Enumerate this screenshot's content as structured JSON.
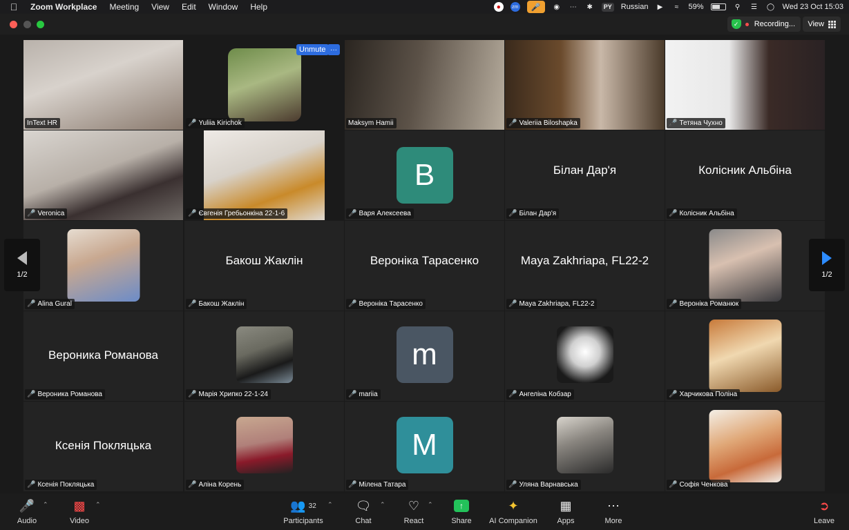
{
  "menubar": {
    "app_name": "Zoom Workplace",
    "items": [
      "Meeting",
      "View",
      "Edit",
      "Window",
      "Help"
    ],
    "keyboard_code": "PY",
    "keyboard_label": "Russian",
    "battery": "59%",
    "datetime": "Wed 23 Oct  15:03",
    "zm_badge": "zm"
  },
  "titlebar": {
    "recording_label": "Recording...",
    "view_label": "View"
  },
  "pager": {
    "left_label": "1/2",
    "right_label": "1/2"
  },
  "self_tile": {
    "unmute_label": "Unmute",
    "more_label": "···"
  },
  "participants": [
    {
      "name": "InText HR",
      "type": "video",
      "active": true
    },
    {
      "name": "Yuliia Kirichok",
      "type": "video"
    },
    {
      "name": "Maksym Hamii",
      "type": "video"
    },
    {
      "name": "Valeriia Biloshapka",
      "type": "video"
    },
    {
      "name": "Тетяна Чухно",
      "type": "video"
    },
    {
      "name": "Veronica",
      "type": "video"
    },
    {
      "name": "Євгенія Гребьонкіна 22-1-6",
      "type": "video"
    },
    {
      "name": "Варя Алексеева",
      "type": "avatar",
      "initial": "B",
      "color": "#2e8b7a"
    },
    {
      "name": "Білан Дар'я",
      "type": "name"
    },
    {
      "name": "Колісник Альбіна",
      "type": "name"
    },
    {
      "name": "Alina Gural",
      "type": "photo"
    },
    {
      "name": "Бакош Жаклін",
      "type": "name"
    },
    {
      "name": "Вероніка Тарасенко",
      "type": "name"
    },
    {
      "name": "Maya Zakhriapa, FL22-2",
      "type": "name"
    },
    {
      "name": "Вероніка Романюк",
      "type": "photo"
    },
    {
      "name": "Вероника Романова",
      "type": "name"
    },
    {
      "name": "Марія Хрипко 22-1-24",
      "type": "photo"
    },
    {
      "name": "mariia",
      "type": "avatar",
      "initial": "m",
      "color": "#4a5663"
    },
    {
      "name": "Ангеліна Кобзар",
      "type": "photo"
    },
    {
      "name": "Харчикова Поліна",
      "type": "photo"
    },
    {
      "name": "Ксенія Покляцька",
      "type": "name"
    },
    {
      "name": "Аліна Корень",
      "type": "photo"
    },
    {
      "name": "Мілена Татара",
      "type": "avatar",
      "initial": "M",
      "color": "#2f8f9a"
    },
    {
      "name": "Уляна Варнавська",
      "type": "photo"
    },
    {
      "name": "Софія Ченкова",
      "type": "photo"
    }
  ],
  "toolbar": {
    "audio": "Audio",
    "video": "Video",
    "participants": "Participants",
    "participants_count": "32",
    "chat": "Chat",
    "react": "React",
    "share": "Share",
    "ai_companion": "AI Companion",
    "apps": "Apps",
    "more": "More",
    "leave": "Leave"
  }
}
